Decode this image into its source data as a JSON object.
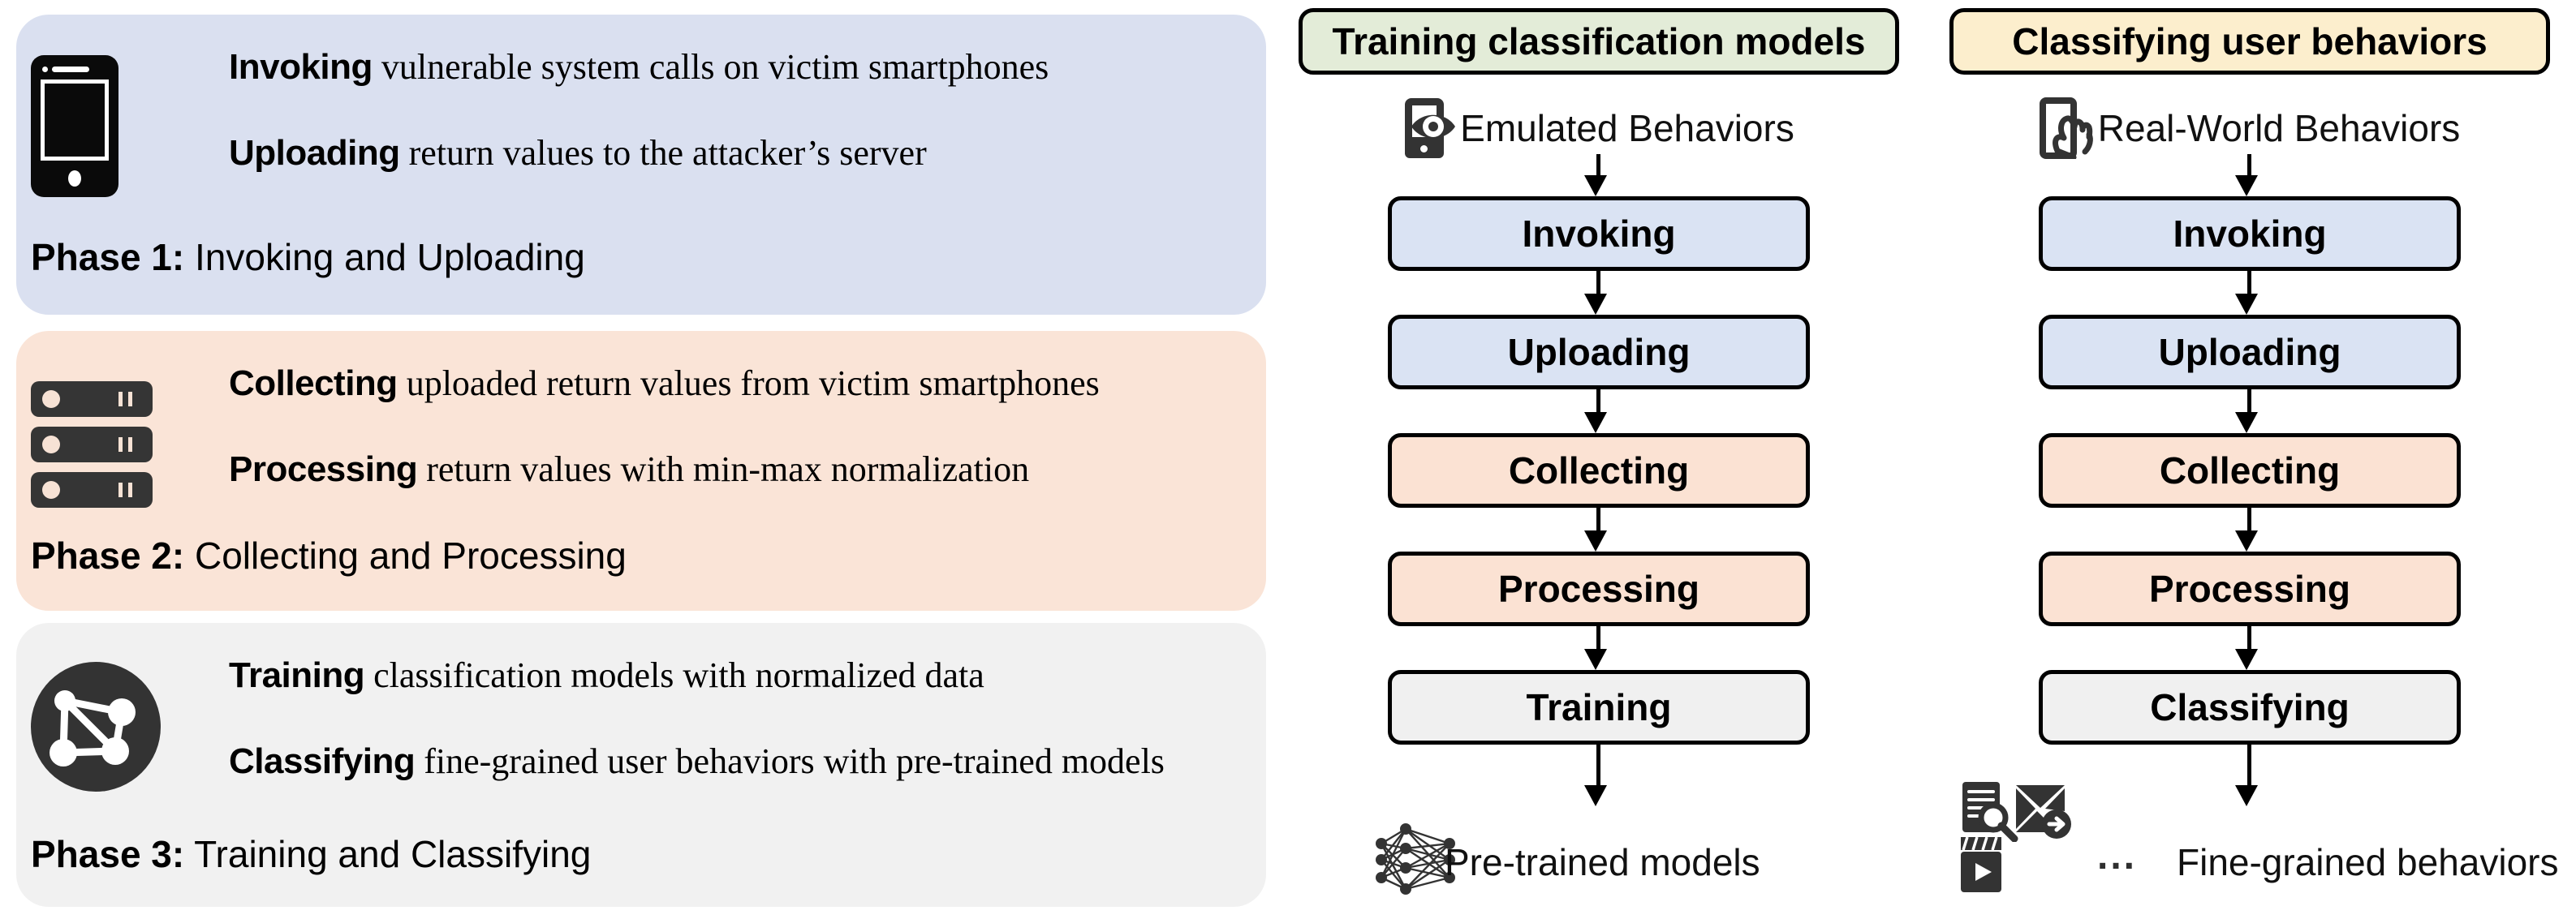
{
  "phases": [
    {
      "id": "phase-1",
      "bg_color": "#dae0f0",
      "icon": "smartphone-icon",
      "lines": [
        {
          "bold": "Invoking",
          "desc": " vulnerable system calls on victim smartphones"
        },
        {
          "bold": "Uploading",
          "desc": " return values to the attacker’s server"
        }
      ],
      "caption_bold": "Phase 1:",
      "caption_rest": " Invoking and Uploading"
    },
    {
      "id": "phase-2",
      "bg_color": "#fae4d7",
      "icon": "server-rack-icon",
      "lines": [
        {
          "bold": "Collecting",
          "desc": " uploaded return values from victim smartphones"
        },
        {
          "bold": "Processing",
          "desc": " return values with min-max normalization"
        }
      ],
      "caption_bold": "Phase 2:",
      "caption_rest": " Collecting and Processing"
    },
    {
      "id": "phase-3",
      "bg_color": "#f1f1f1",
      "icon": "graph-model-icon",
      "lines": [
        {
          "bold": "Training",
          "desc": " classification models with normalized data"
        },
        {
          "bold": "Classifying",
          "desc": " fine-grained user behaviors with pre-trained models"
        }
      ],
      "caption_bold": "Phase 3:",
      "caption_rest": " Training and Classifying"
    }
  ],
  "flows": [
    {
      "id": "flow-training",
      "header": "Training classification models",
      "header_color": "#e3ecd8",
      "source_label": "Emulated Behaviors",
      "source_icon": "phone-eye-icon",
      "steps": [
        {
          "label": "Invoking",
          "color": "#dae3f3"
        },
        {
          "label": "Uploading",
          "color": "#dae3f3"
        },
        {
          "label": "Collecting",
          "color": "#fbe2d3"
        },
        {
          "label": "Processing",
          "color": "#fbe2d3"
        },
        {
          "label": "Training",
          "color": "#f0f0f0"
        }
      ],
      "result_label": "Pre-trained models",
      "result_icon": "neural-network-icon"
    },
    {
      "id": "flow-classifying",
      "header": "Classifying user behaviors",
      "header_color": "#fceecd",
      "source_label": "Real-World Behaviors",
      "source_icon": "hand-tap-phone-icon",
      "steps": [
        {
          "label": "Invoking",
          "color": "#dae3f3"
        },
        {
          "label": "Uploading",
          "color": "#dae3f3"
        },
        {
          "label": "Collecting",
          "color": "#fbe2d3"
        },
        {
          "label": "Processing",
          "color": "#fbe2d3"
        },
        {
          "label": "Classifying",
          "color": "#f0f0f0"
        }
      ],
      "result_label": "Fine-grained behaviors",
      "result_ellipsis": "...",
      "result_icons": [
        "document-search-icon",
        "envelope-send-icon",
        "video-clapper-icon"
      ]
    }
  ],
  "colors": {
    "blue_step": "#dae3f3",
    "peach_step": "#fbe2d3",
    "gray_step": "#f0f0f0",
    "panel_blue": "#dae0f0",
    "panel_peach": "#fae4d7",
    "panel_gray": "#f1f1f1",
    "header_green": "#e3ecd8",
    "header_cream": "#fceecd",
    "stroke": "#000000"
  }
}
